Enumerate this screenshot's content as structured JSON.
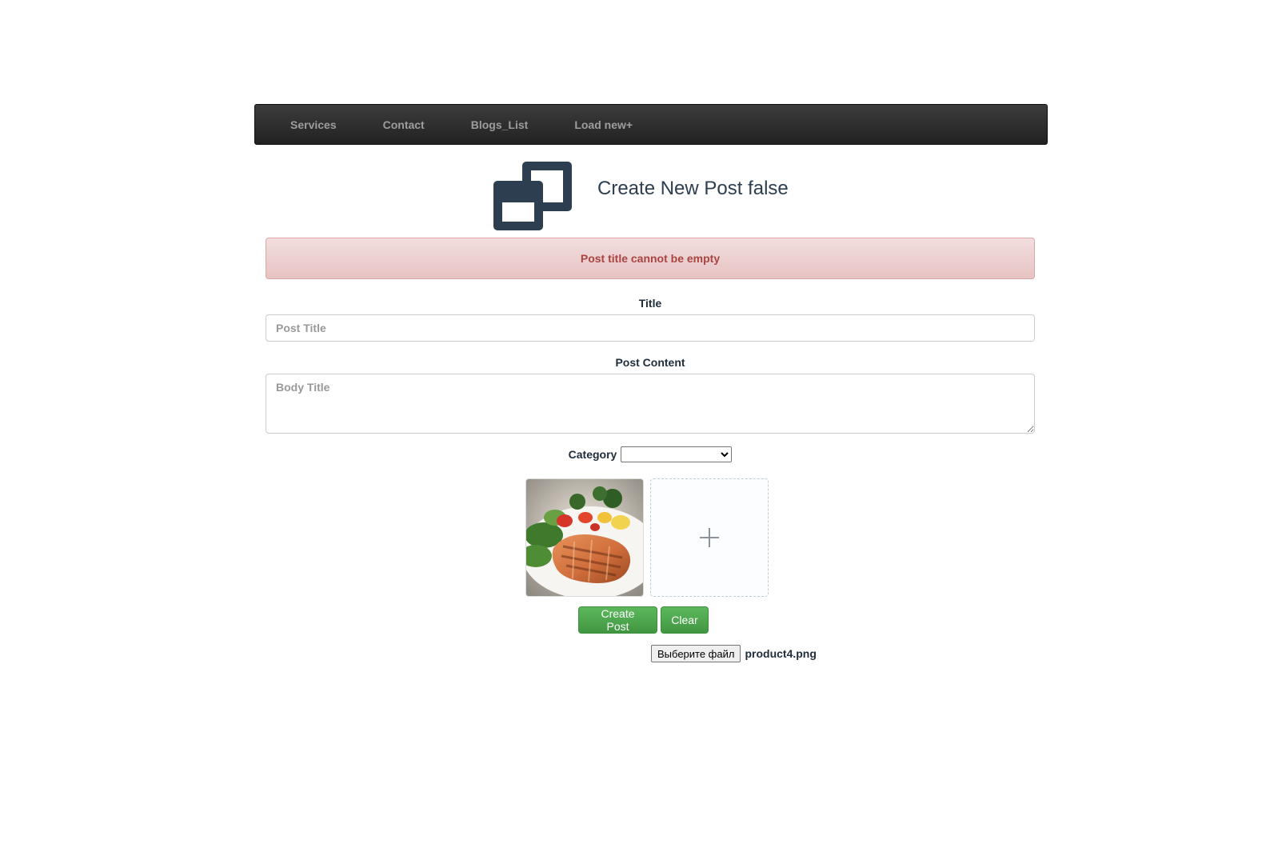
{
  "nav": {
    "items": [
      {
        "label": "Services"
      },
      {
        "label": "Contact"
      },
      {
        "label": "Blogs_List"
      },
      {
        "label": "Load new+"
      }
    ]
  },
  "header": {
    "logo_icon": "restore-window-icon",
    "title": "Create New Post false"
  },
  "alert": {
    "message": "Post title cannot be empty"
  },
  "form": {
    "title_label": "Title",
    "title_placeholder": "Post Title",
    "title_value": "",
    "content_label": "Post Content",
    "content_placeholder": "Body Title",
    "content_value": "",
    "category_label": "Category",
    "category_selected": "",
    "images": {
      "uploaded_thumbnail": "grilled-salmon-salad-photo",
      "add_icon": "plus-icon"
    },
    "create_button": "Create Post",
    "clear_button": "Clear",
    "file_button": "Выберите файл",
    "file_name": "product4.png"
  },
  "colors": {
    "navbar": "#222222",
    "nav_text": "#9d9d9d",
    "alert_bg": "#f2dede",
    "alert_text": "#a94442",
    "button_green": "#5cb85c",
    "title_text": "#2c3e50"
  }
}
